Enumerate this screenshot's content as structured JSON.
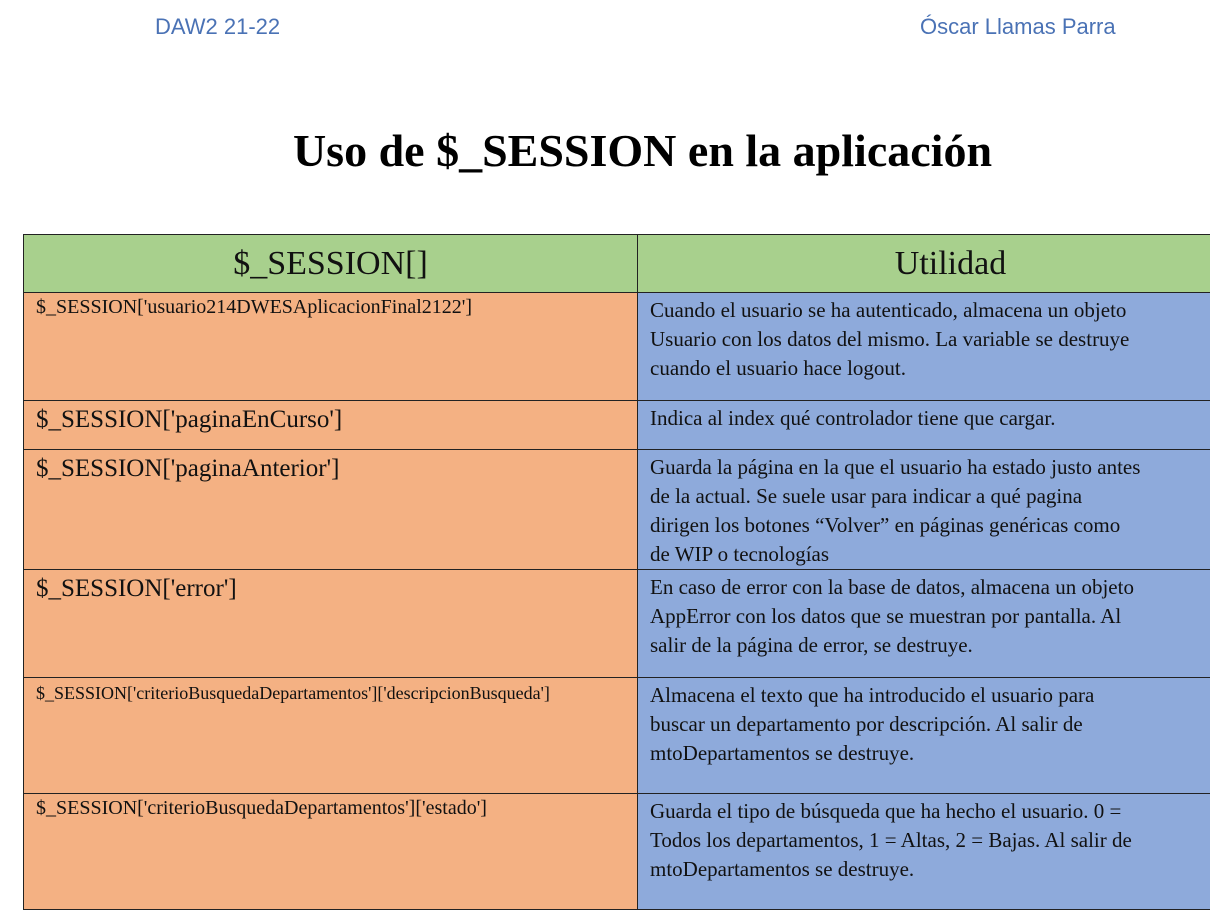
{
  "header": {
    "left": "DAW2 21-22",
    "right": "Óscar Llamas Parra"
  },
  "title": "Uso de $_SESSION en la aplicación",
  "table": {
    "columns": [
      "$_SESSION[]",
      "Utilidad"
    ],
    "rows": [
      {
        "key": "$_SESSION['usuario214DWESAplicacionFinal2122']",
        "lines": [
          "Cuando el usuario se ha autenticado, almacena un objeto",
          "Usuario con los datos del mismo. La variable se destruye",
          "cuando el usuario hace logout."
        ]
      },
      {
        "key": "$_SESSION['paginaEnCurso']",
        "lines": [
          "Indica al index qué controlador tiene que cargar."
        ]
      },
      {
        "key": "$_SESSION['paginaAnterior']",
        "lines": [
          "Guarda la página en la que el usuario ha estado justo antes",
          "de la actual. Se suele usar para indicar a qué pagina",
          "dirigen los botones “Volver” en páginas genéricas como",
          "de WIP o tecnologías"
        ]
      },
      {
        "key": "$_SESSION['error']",
        "lines": [
          "En caso de error con la base de datos, almacena un objeto",
          "AppError con los datos que se muestran por pantalla. Al",
          "salir de la página de error, se destruye."
        ]
      },
      {
        "key": "$_SESSION['criterioBusquedaDepartamentos']['descripcionBusqueda']",
        "lines": [
          "Almacena el texto que ha introducido el usuario para",
          "buscar un departamento por descripción. Al salir de",
          "mtoDepartamentos se destruye."
        ]
      },
      {
        "key": "$_SESSION['criterioBusquedaDepartamentos']['estado']",
        "lines": [
          "Guarda el tipo de búsqueda que ha hecho el usuario. 0 =",
          "Todos los departamentos, 1 = Altas, 2 = Bajas. Al salir de",
          "mtoDepartamentos se destruye."
        ]
      }
    ]
  }
}
